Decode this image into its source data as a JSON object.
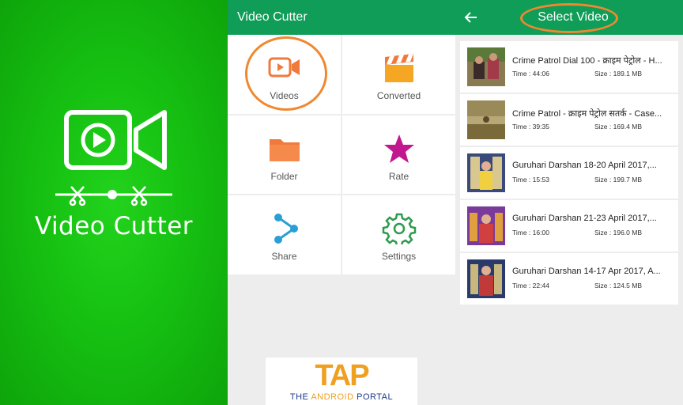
{
  "promo": {
    "title": "Video Cutter"
  },
  "main_menu": {
    "header_title": "Video Cutter",
    "items": [
      {
        "label": "Videos",
        "icon": "video-camera-icon",
        "color": "#f07a3c"
      },
      {
        "label": "Converted",
        "icon": "clapperboard-icon",
        "color": "#f5a623"
      },
      {
        "label": "Folder",
        "icon": "folder-icon",
        "color": "#f07a3c"
      },
      {
        "label": "Rate",
        "icon": "star-icon",
        "color": "#c2188f"
      },
      {
        "label": "Share",
        "icon": "share-icon",
        "color": "#2a9fd6"
      },
      {
        "label": "Settings",
        "icon": "gear-icon",
        "color": "#2e9a4e"
      }
    ]
  },
  "watermark": {
    "letters": "TAP",
    "subtitle_a": "THE ",
    "subtitle_b": "ANDROID",
    "subtitle_c": " PORTAL"
  },
  "select_video": {
    "header_title": "Select Video",
    "videos": [
      {
        "name": "Crime Patrol Dial 100 - क्राइम पेट्रोल - H...",
        "time": "Time : 44:06",
        "size": "Size : 189.1 MB"
      },
      {
        "name": "Crime Patrol - क्राइम पेट्रोल सतर्क - Case...",
        "time": "Time : 39:35",
        "size": "Size : 169.4 MB"
      },
      {
        "name": "Guruhari Darshan 18-20 April 2017,...",
        "time": "Time : 15:53",
        "size": "Size : 199.7 MB"
      },
      {
        "name": "Guruhari Darshan 21-23 April 2017,...",
        "time": "Time : 16:00",
        "size": "Size : 196.0 MB"
      },
      {
        "name": "Guruhari Darshan 14-17 Apr 2017, A...",
        "time": "Time : 22:44",
        "size": "Size : 124.5 MB"
      }
    ]
  },
  "colors": {
    "app_bar": "#0f9d58",
    "promo_green": "#16c012",
    "highlight_ring": "#f08830"
  }
}
